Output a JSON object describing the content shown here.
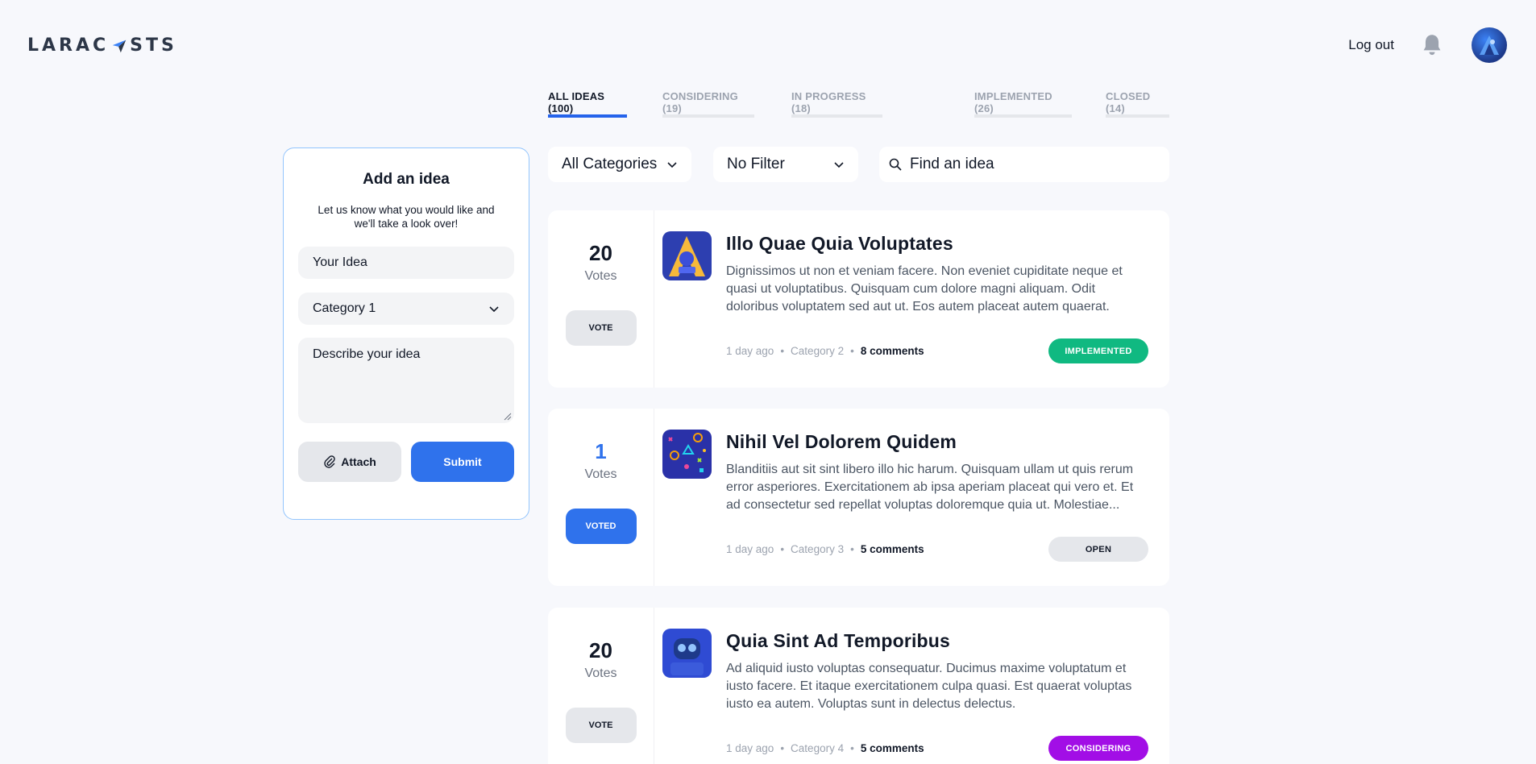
{
  "header": {
    "logo_text_left": "LARAC",
    "logo_text_right": "STS",
    "logout_label": "Log out"
  },
  "tabs": [
    {
      "label": "ALL IDEAS (100)",
      "active": true
    },
    {
      "label": "CONSIDERING (19)",
      "active": false
    },
    {
      "label": "IN PROGRESS (18)",
      "active": false
    },
    {
      "label": "IMPLEMENTED (26)",
      "active": false
    },
    {
      "label": "CLOSED (14)",
      "active": false
    }
  ],
  "add_idea": {
    "title": "Add an idea",
    "subtitle": "Let us know what you would like and we'll take a look over!",
    "idea_placeholder": "Your Idea",
    "category_value": "Category 1",
    "description_placeholder": "Describe your idea",
    "attach_label": "Attach",
    "submit_label": "Submit"
  },
  "filters": {
    "category_value": "All Categories",
    "filter_value": "No Filter",
    "search_placeholder": "Find an idea"
  },
  "ideas": [
    {
      "votes": "20",
      "votes_label": "Votes",
      "vote_button": "VOTE",
      "voted": false,
      "title": "Illo Quae Quia Voluptates",
      "description": "Dignissimos ut non et veniam facere. Non eveniet cupiditate neque et quasi ut voluptatibus. Quisquam cum dolore magni aliquam. Odit doloribus voluptatem sed aut ut. Eos autem placeat autem quaerat.",
      "time": "1 day ago",
      "category": "Category 2",
      "comments": "8 comments",
      "status": "IMPLEMENTED",
      "status_bg": "#10b981",
      "status_color": "#ffffff"
    },
    {
      "votes": "1",
      "votes_label": "Votes",
      "vote_button": "VOTED",
      "voted": true,
      "title": "Nihil Vel Dolorem Quidem",
      "description": "Blanditiis aut sit sint libero illo hic harum. Quisquam ullam ut quis rerum error asperiores. Exercitationem ab ipsa aperiam placeat qui vero et. Et ad consectetur sed repellat voluptas doloremque quia ut. Molestiae...",
      "time": "1 day ago",
      "category": "Category 3",
      "comments": "5 comments",
      "status": "OPEN",
      "status_bg": "#e5e7eb",
      "status_color": "#111827"
    },
    {
      "votes": "20",
      "votes_label": "Votes",
      "vote_button": "VOTE",
      "voted": false,
      "title": "Quia Sint Ad Temporibus",
      "description": "Ad aliquid iusto voluptas consequatur. Ducimus maxime voluptatum et iusto facere. Et itaque exercitationem culpa quasi. Est quaerat voluptas iusto ea autem. Voluptas sunt in delectus delectus.",
      "time": "1 day ago",
      "category": "Category 4",
      "comments": "5 comments",
      "status": "CONSIDERING",
      "status_bg": "#a20ee6",
      "status_color": "#ffffff"
    }
  ],
  "meta_separator": "•",
  "colors": {
    "accent": "#2f72ec",
    "background": "#f7f8fc"
  }
}
